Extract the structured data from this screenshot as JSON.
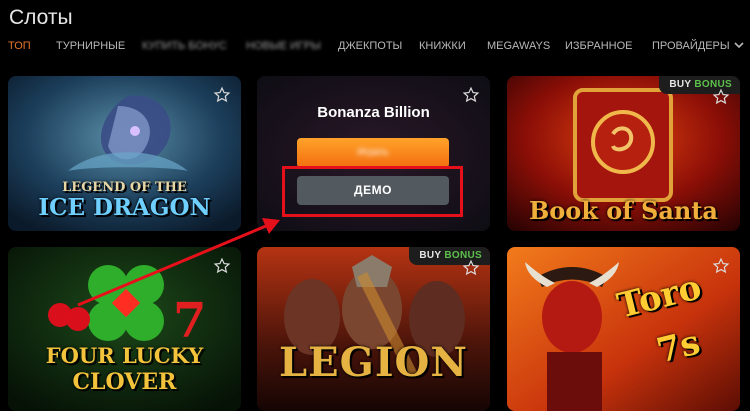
{
  "page": {
    "title": "Слоты"
  },
  "tabs": [
    {
      "label": "ТОП"
    },
    {
      "label": "ТУРНИРНЫЕ"
    },
    {
      "label": "КУПИТЬ БОНУС"
    },
    {
      "label": "НОВЫЕ ИГРЫ"
    },
    {
      "label": "ДЖЕКПОТЫ"
    },
    {
      "label": "КНИЖКИ"
    },
    {
      "label": "MEGAWAYS"
    },
    {
      "label": "ИЗБРАННОЕ"
    },
    {
      "label": "ПРОВАЙДЕРЫ"
    }
  ],
  "badge": {
    "part1": "BUY",
    "part2": "BONUS"
  },
  "games": [
    {
      "line1": "LEGEND OF THE",
      "line2": "ICE DRAGON"
    },
    {
      "title": "Bonanza Billion",
      "play_label": "Играть",
      "demo_label": "ДЕМО"
    },
    {
      "line1": "Book of Santa"
    },
    {
      "line1": "FOUR LUCKY",
      "line2": "CLOVER"
    },
    {
      "line1": "LEGION"
    },
    {
      "line1": "Toro",
      "line2": "7s"
    }
  ],
  "colors": {
    "accent": "#e2762a",
    "buy_bonus": "#5cc04a",
    "highlight": "#e6101b"
  },
  "icons": {
    "favorite": "star-outline-icon",
    "dropdown": "chevron-down-icon"
  }
}
